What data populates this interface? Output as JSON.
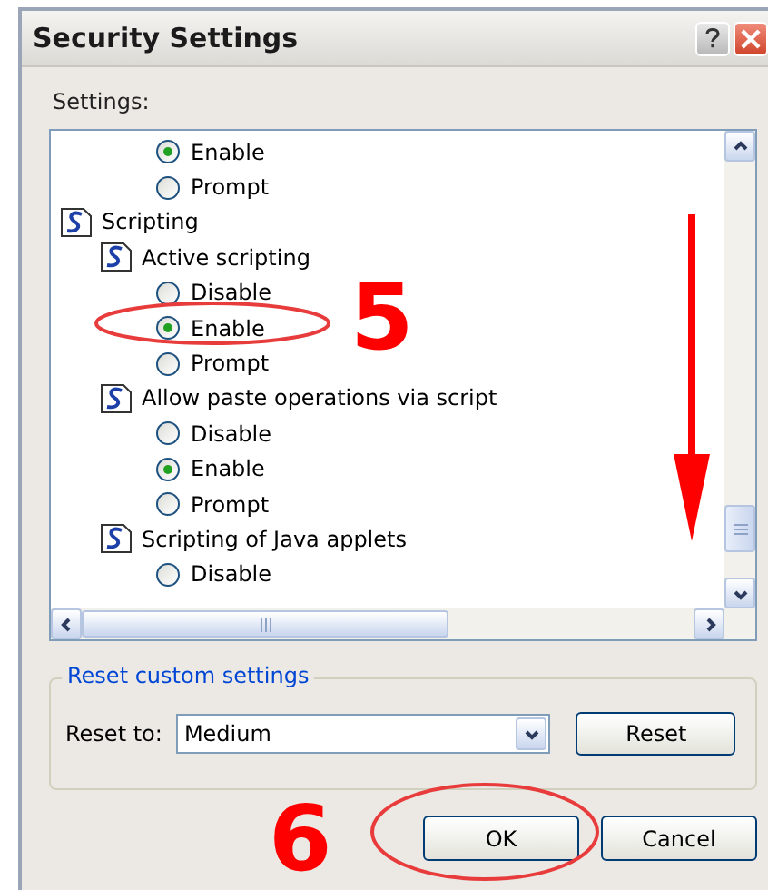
{
  "window": {
    "title": "Security Settings"
  },
  "settings_label": "Settings:",
  "settings": [
    {
      "kind": "option",
      "label": "Enable",
      "selected": true
    },
    {
      "kind": "option",
      "label": "Prompt",
      "selected": false
    },
    {
      "kind": "category",
      "label": "Scripting",
      "children": [
        {
          "kind": "setting",
          "label": "Active scripting",
          "children": [
            {
              "kind": "option",
              "label": "Disable",
              "selected": false
            },
            {
              "kind": "option",
              "label": "Enable",
              "selected": true
            },
            {
              "kind": "option",
              "label": "Prompt",
              "selected": false
            }
          ]
        },
        {
          "kind": "setting",
          "label": "Allow paste operations via script",
          "children": [
            {
              "kind": "option",
              "label": "Disable",
              "selected": false
            },
            {
              "kind": "option",
              "label": "Enable",
              "selected": true
            },
            {
              "kind": "option",
              "label": "Prompt",
              "selected": false
            }
          ]
        },
        {
          "kind": "setting",
          "label": "Scripting of Java applets",
          "children": [
            {
              "kind": "option",
              "label": "Disable",
              "selected": false
            }
          ]
        }
      ]
    }
  ],
  "reset_group": {
    "title": "Reset custom settings",
    "label": "Reset to:",
    "value": "Medium",
    "button": "Reset"
  },
  "buttons": [
    "OK",
    "Cancel"
  ],
  "annotations": [
    {
      "kind": "step",
      "text": "5"
    },
    {
      "kind": "step",
      "text": "6"
    }
  ]
}
